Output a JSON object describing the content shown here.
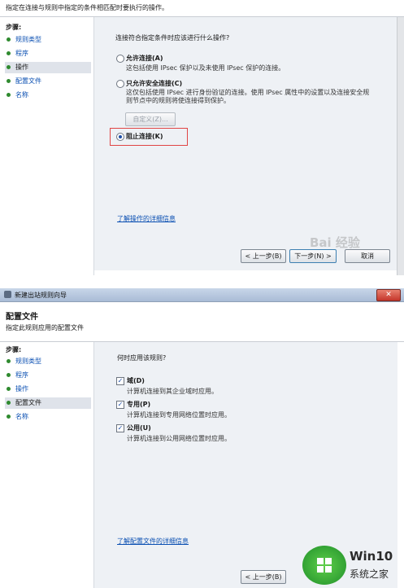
{
  "panel1": {
    "description": "指定在连接与规则中指定的条件相匹配时要执行的操作。",
    "steps_title": "步骤:",
    "steps": [
      {
        "label": "规则类型",
        "active": false
      },
      {
        "label": "程序",
        "active": false
      },
      {
        "label": "操作",
        "active": true
      },
      {
        "label": "配置文件",
        "active": false
      },
      {
        "label": "名称",
        "active": false
      }
    ],
    "question": "连接符合指定条件时应该进行什么操作?",
    "options": [
      {
        "label": "允许连接(A)",
        "desc": "这包括使用 IPsec 保护以及未使用 IPsec 保护的连接。",
        "selected": false
      },
      {
        "label": "只允许安全连接(C)",
        "desc": "这仅包括使用 IPsec 进行身份验证的连接。使用 IPsec 属性中的设置以及连接安全规则节点中的规则将使连接得到保护。",
        "selected": false
      },
      {
        "label": "阻止连接(K)",
        "selected": true
      }
    ],
    "customize_label": "自定义(Z)...",
    "learn_more": "了解操作的详细信息",
    "back_label": "< 上一步(B)",
    "next_label": "下一步(N) >",
    "cancel_label": "取消"
  },
  "panel2": {
    "window_title": "新建出站规则向导",
    "page_title": "配置文件",
    "page_subtitle": "指定此规则应用的配置文件",
    "steps_title": "步骤:",
    "steps": [
      {
        "label": "规则类型",
        "active": false
      },
      {
        "label": "程序",
        "active": false
      },
      {
        "label": "操作",
        "active": false
      },
      {
        "label": "配置文件",
        "active": true
      },
      {
        "label": "名称",
        "active": false
      }
    ],
    "question": "何时应用该规则?",
    "checks": [
      {
        "label": "域(D)",
        "desc": "计算机连接到其企业域时应用。",
        "checked": true
      },
      {
        "label": "专用(P)",
        "desc": "计算机连接到专用网络位置时应用。",
        "checked": true
      },
      {
        "label": "公用(U)",
        "desc": "计算机连接到公用网络位置时应用。",
        "checked": true
      }
    ],
    "learn_more": "了解配置文件的详细信息",
    "back_label": "< 上一步(B)"
  },
  "watermark": {
    "main": "Win10",
    "sub": "系统之家",
    "baidu": "Bai 经验"
  }
}
